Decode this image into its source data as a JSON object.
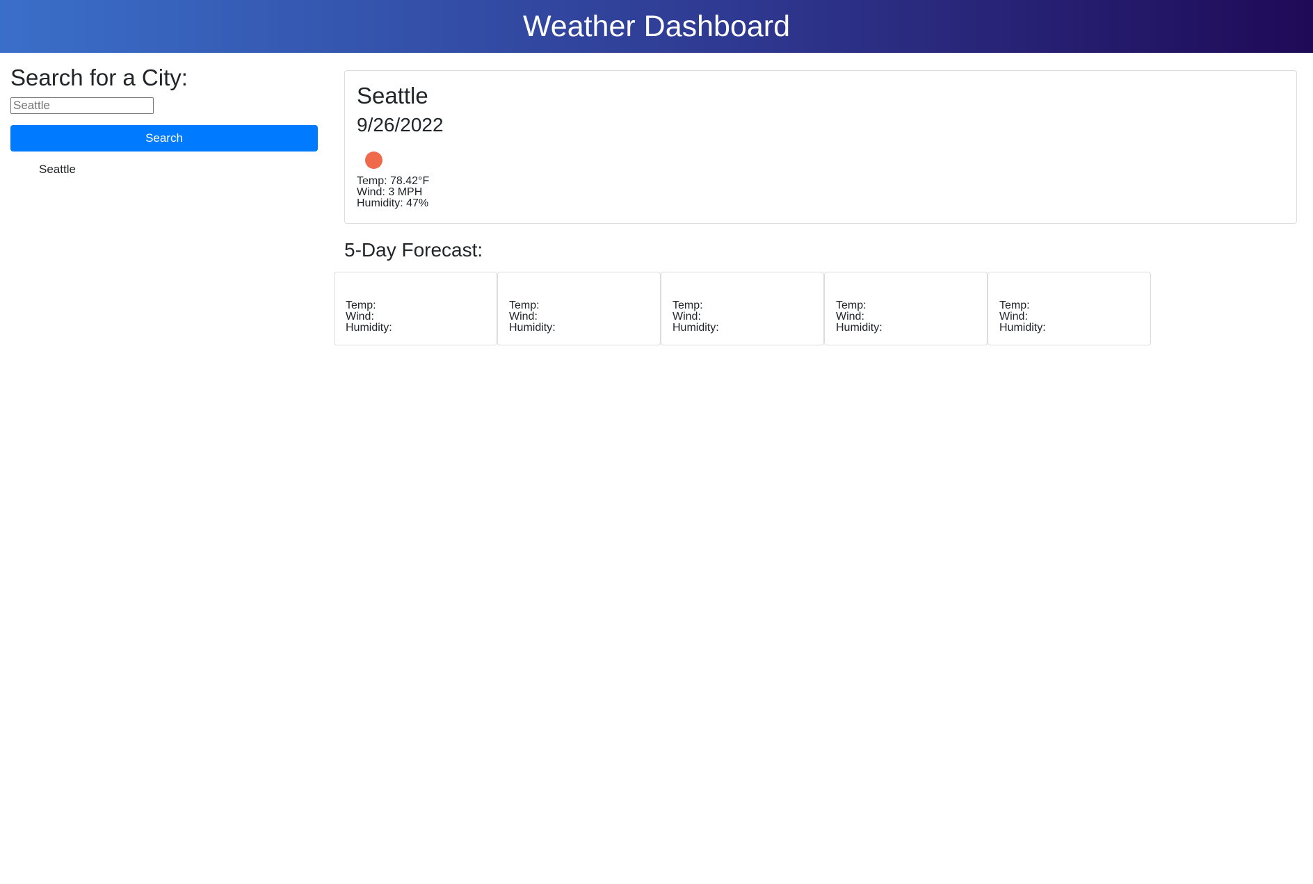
{
  "header": {
    "title": "Weather Dashboard"
  },
  "sidebar": {
    "heading": "Search for a City:",
    "search_placeholder": "Seattle",
    "search_button_label": "Search",
    "history": [
      "Seattle"
    ]
  },
  "current": {
    "city": "Seattle",
    "date": "9/26/2022",
    "icon": "sun-icon",
    "icon_color": "#ee6a4b",
    "temp_line": "Temp: 78.42°F",
    "wind_line": "Wind: 3 MPH",
    "humidity_line": "Humidity: 47%"
  },
  "forecast": {
    "heading": "5-Day Forecast:",
    "days": [
      {
        "temp": "Temp:",
        "wind": "Wind:",
        "humidity": "Humidity:"
      },
      {
        "temp": "Temp:",
        "wind": "Wind:",
        "humidity": "Humidity:"
      },
      {
        "temp": "Temp:",
        "wind": "Wind:",
        "humidity": "Humidity:"
      },
      {
        "temp": "Temp:",
        "wind": "Wind:",
        "humidity": "Humidity:"
      },
      {
        "temp": "Temp:",
        "wind": "Wind:",
        "humidity": "Humidity:"
      }
    ]
  },
  "colors": {
    "header_gradient_start": "#3a6fc9",
    "header_gradient_end": "#1f0a57",
    "button_blue": "#007bff"
  }
}
